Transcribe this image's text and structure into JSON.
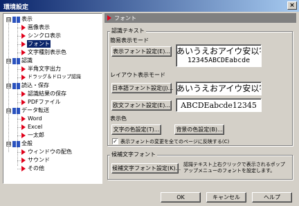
{
  "window": {
    "title": "環境設定",
    "close_label": "×"
  },
  "tree": {
    "root_nodes": [
      {
        "label": "表示",
        "expander": "⊟"
      },
      {
        "label": "認識",
        "expander": "⊟"
      },
      {
        "label": "読込・保存",
        "expander": "⊟"
      },
      {
        "label": "データ転送",
        "expander": "⊟"
      },
      {
        "label": "全般",
        "expander": "⊟"
      }
    ],
    "children": {
      "display": [
        "画像表示",
        "シンクロ表示",
        "フォント",
        "文字種別表示色"
      ],
      "recognize": [
        "半角文字出力",
        "ドラッグ＆ドロップ認識"
      ],
      "load_save": [
        "認識結果の保存",
        "PDFファイル"
      ],
      "transfer": [
        "Word",
        "Excel",
        "一太郎"
      ],
      "general": [
        "ウィンドウの配色",
        "サウンド",
        "その他"
      ]
    },
    "selected": "フォント"
  },
  "panel": {
    "header": "フォント",
    "recog_group": {
      "title": "認識テキスト",
      "simple_mode": "簡易表示モード",
      "simple_btn": "表示フォント設定(E)...",
      "simple_preview_line1": "あいうえおアイウ安以字",
      "simple_preview_line2": "12345ABCDEabcde",
      "layout_mode": "レイアウト表示モード",
      "jp_btn": "日本語フォント設定(J)...",
      "jp_preview": "あいうえおアイウ安以字",
      "en_btn": "欧文フォント設定(E)...",
      "en_preview": "ABCDEabcde12345",
      "color_label": "表示色",
      "text_color_btn": "文字の色設定(T)...",
      "bg_color_btn": "背景の色設定(B)...",
      "check_mark": "✓",
      "reflect_label": "表示フォントの変更を全てのページに反映する(C)"
    },
    "cand_group": {
      "title": "候補文字フォント",
      "btn": "候補文字フォント設定(K)...",
      "desc_line1": "認識テキスト上右クリックで表示されるポップ",
      "desc_line2": "アップメニューのフォントを設定します。"
    }
  },
  "footer": {
    "ok": "OK",
    "cancel": "キャンセル",
    "help": "ヘルプ"
  },
  "colors": {
    "title_start": "#0a246a",
    "title_end": "#a6caf0",
    "face": "#d4d0c8",
    "arrow": "#e0001a",
    "selection": "#0a246a"
  }
}
